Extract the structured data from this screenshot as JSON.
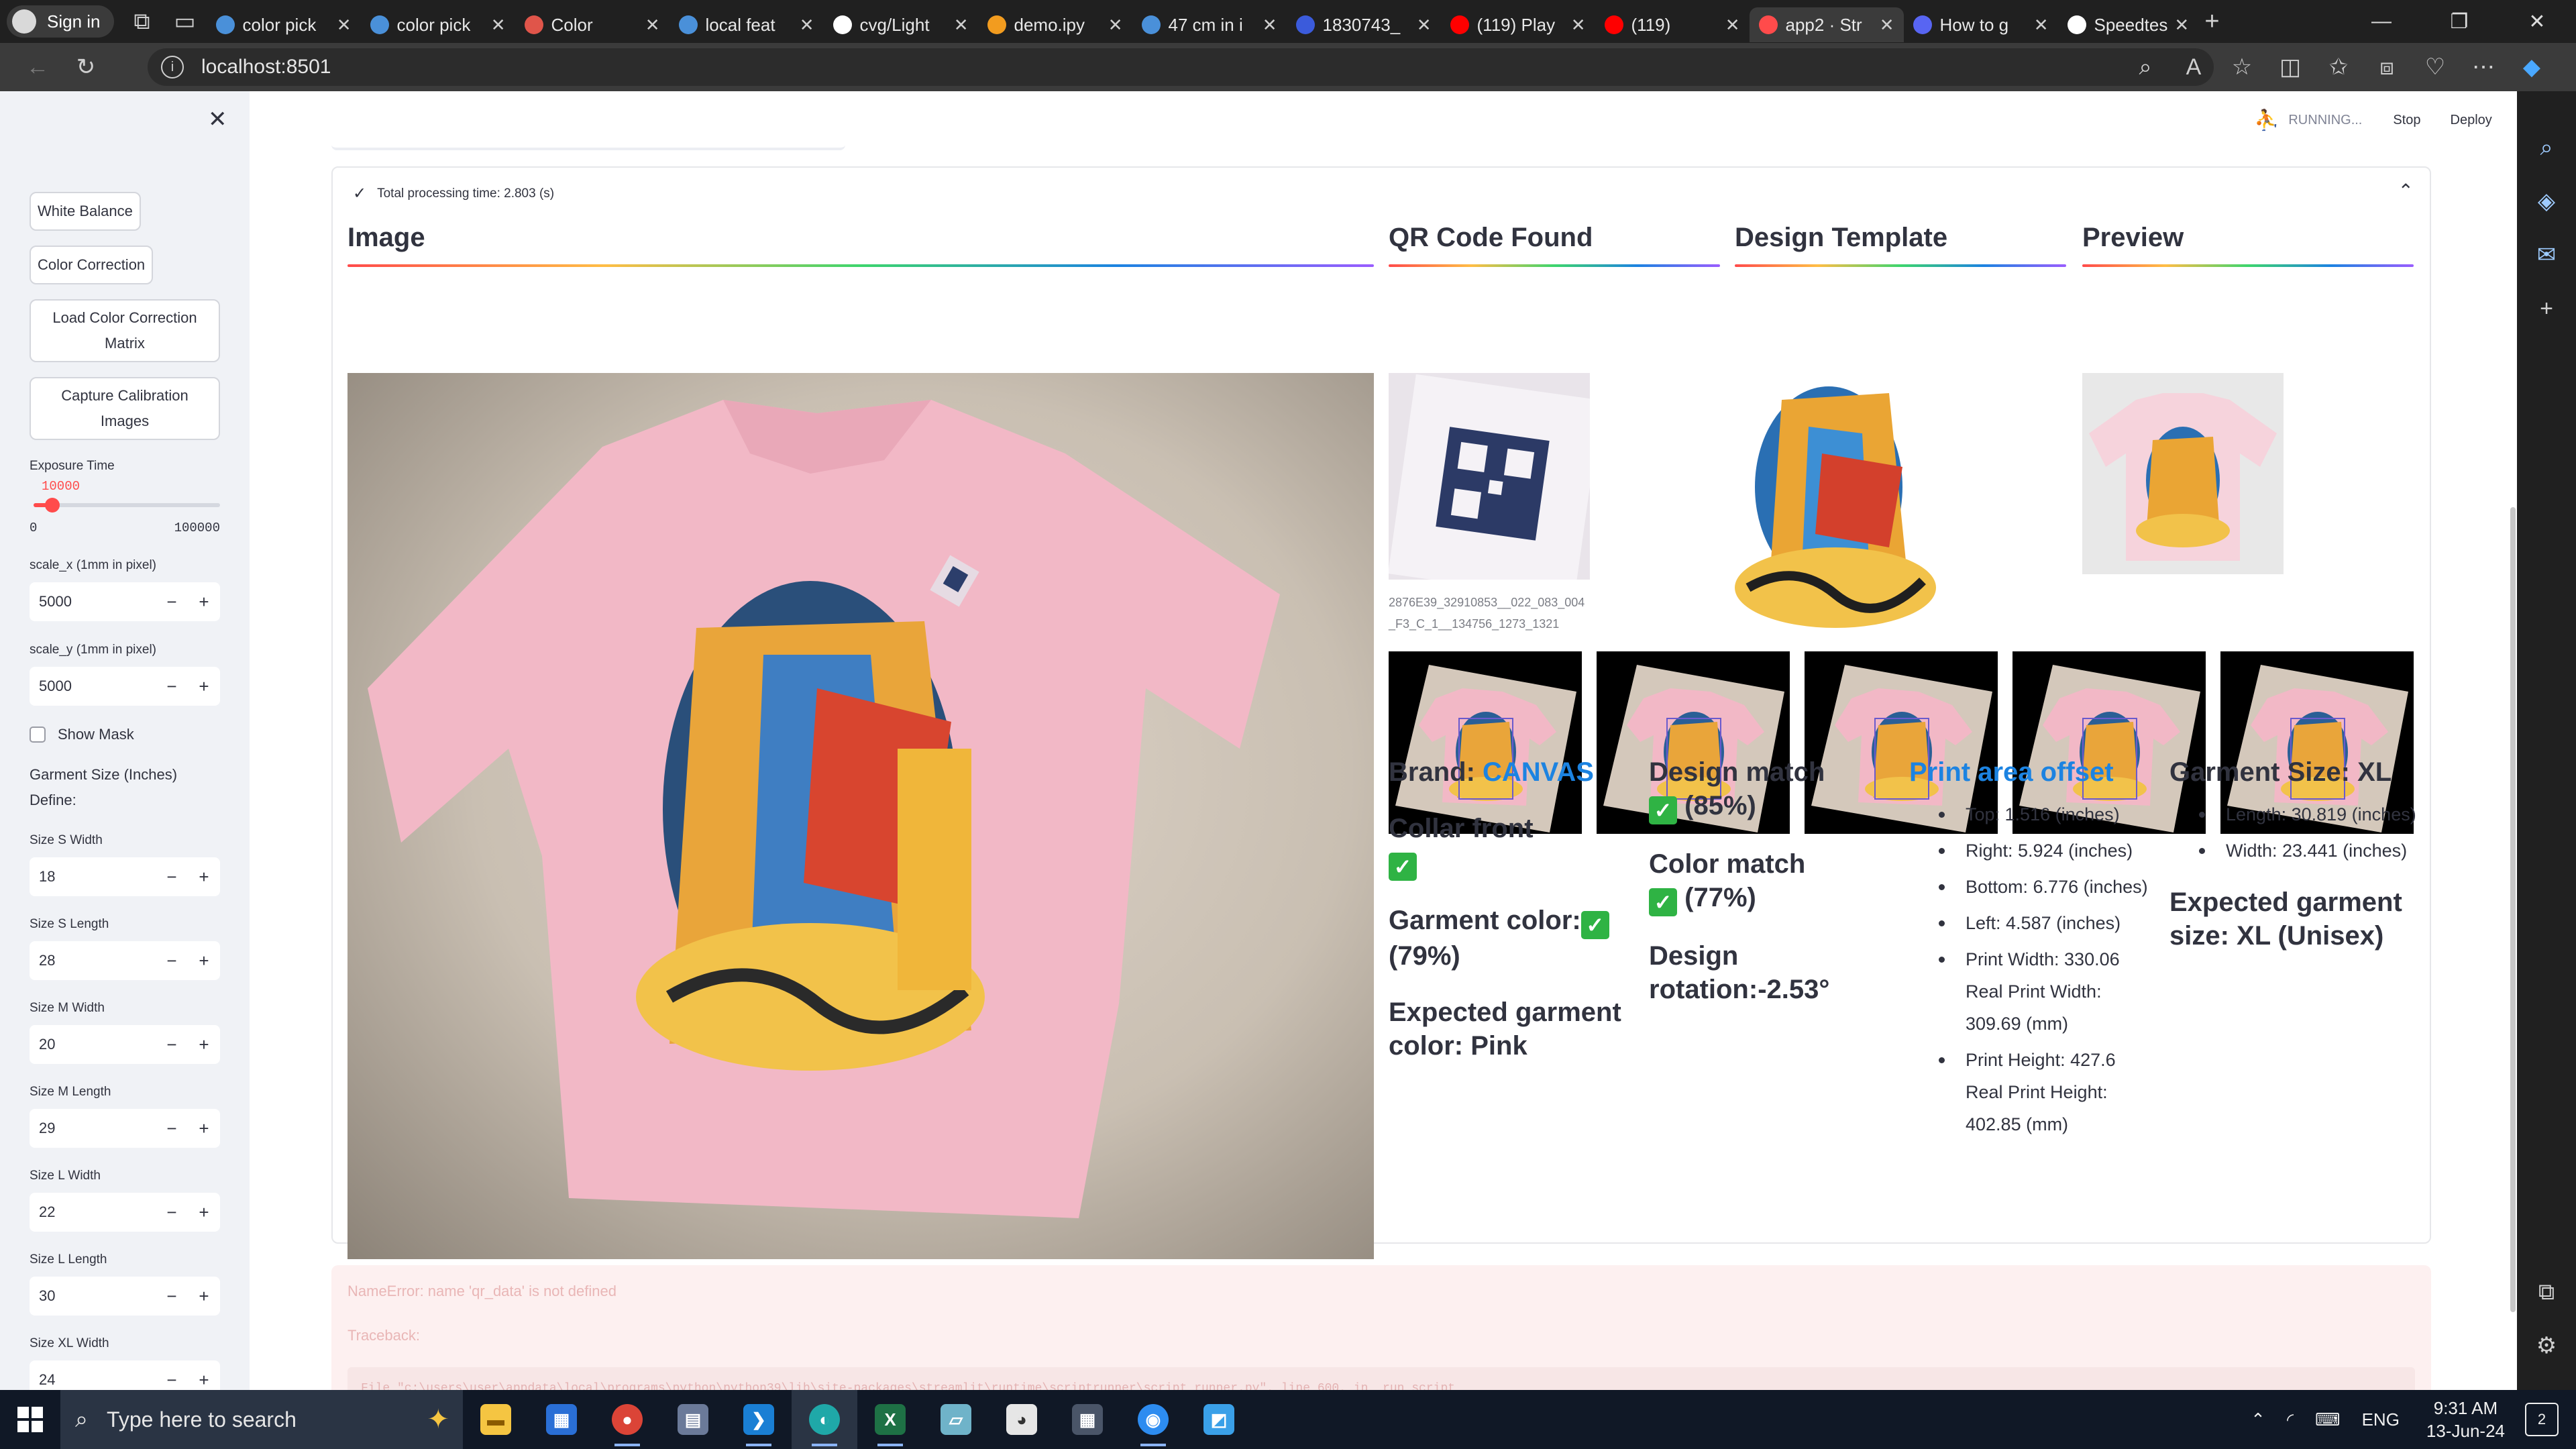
{
  "browser": {
    "profile_label": "Sign in",
    "tabs": [
      {
        "title": "color pick",
        "fav_color": "#4a90d9"
      },
      {
        "title": "color pick",
        "fav_color": "#4a90d9"
      },
      {
        "title": "Color",
        "fav_color": "#e0554a"
      },
      {
        "title": "local feat",
        "fav_color": "#4a90d9"
      },
      {
        "title": "cvg/Light",
        "fav_color": "#ffffff"
      },
      {
        "title": "demo.ipy",
        "fav_color": "#f29c1f"
      },
      {
        "title": "47 cm in i",
        "fav_color": "#4a90d9"
      },
      {
        "title": "1830743_",
        "fav_color": "#3b5bdb"
      },
      {
        "title": "(119) Play",
        "fav_color": "#ff0000"
      },
      {
        "title": "(119)",
        "fav_color": "#ff0000"
      },
      {
        "title": "app2 · Str",
        "fav_color": "#ff4b4b"
      },
      {
        "title": "How to g",
        "fav_color": "#5865f2"
      },
      {
        "title": "Speedtes",
        "fav_color": "#ffffff"
      }
    ],
    "url": "localhost:8501"
  },
  "app": {
    "header": {
      "status": "RUNNING...",
      "stop": "Stop",
      "deploy": "Deploy"
    },
    "sidebar": {
      "white_balance": "White Balance",
      "color_correction": "Color Correction",
      "load_ccm": "Load Color Correction Matrix",
      "capture_calibration": "Capture Calibration Images",
      "exposure_label": "Exposure Time",
      "exposure_value": "10000",
      "exposure_min": "0",
      "exposure_max": "100000",
      "exposure_fraction": 0.1,
      "scale_x_label": "scale_x (1mm in pixel)",
      "scale_x": "5000",
      "scale_y_label": "scale_y (1mm in pixel)",
      "scale_y": "5000",
      "show_mask": "Show Mask",
      "garment_size_title": "Garment Size (Inches)",
      "define": "Define:",
      "sizes": [
        {
          "label": "Size S Width",
          "value": "18"
        },
        {
          "label": "Size S Length",
          "value": "28"
        },
        {
          "label": "Size M Width",
          "value": "20"
        },
        {
          "label": "Size M Length",
          "value": "29"
        },
        {
          "label": "Size L Width",
          "value": "22"
        },
        {
          "label": "Size L Length",
          "value": "30"
        },
        {
          "label": "Size XL Width",
          "value": "24"
        }
      ]
    },
    "expander": {
      "status": "Total processing time: 2.803 (s)",
      "image_header": "Image",
      "qr_header": "QR Code Found",
      "design_header": "Design Template",
      "preview_header": "Preview",
      "qr_caption": "2876E39_32910853__022_083_004_F3_C_1__134756_1273_1321",
      "brand_label": "Brand:",
      "brand_value": "CANVAS",
      "collar_front": "Collar front",
      "garment_color": "Garment color:",
      "garment_color_pct": "(79%)",
      "expected_color": "Expected garment color: Pink",
      "design_match": "Design match",
      "design_match_pct": "(85%)",
      "color_match": "Color match",
      "color_match_pct": "(77%)",
      "design_rotation": "Design rotation:-2.53°",
      "print_area_title": "Print area offset",
      "print_area": [
        "Top: 1.516 (inches)",
        "Right: 5.924 (inches)",
        "Bottom: 6.776 (inches)",
        "Left: 4.587 (inches)",
        "Print Width: 330.06 Real Print Width: 309.69 (mm)",
        "Print Height: 427.6 Real Print Height: 402.85 (mm)"
      ],
      "garment_size_title": "Garment Size: XL",
      "garment_size": [
        "Length: 30.819 (inches)",
        "Width: 23.441 (inches)"
      ],
      "expected_size": "Expected garment size: XL (Unisex)"
    },
    "error": {
      "message": "NameError: name 'qr_data' is not defined",
      "traceback": "Traceback:",
      "code": "File \"c:\\users\\user\\appdata\\local\\programs\\python\\python39\\lib\\site-packages\\streamlit\\runtime\\scriptrunner\\script_runner.py\", line 600, in _run_script"
    }
  },
  "taskbar": {
    "search_placeholder": "Type here to search",
    "language": "ENG",
    "time": "9:31 AM",
    "date": "13-Jun-24",
    "notifications": "2"
  },
  "colors": {
    "accent": "#ff4b4b",
    "link_blue": "#1c83e1",
    "check_green": "#2fb344",
    "shirt_pink": "#f2b8c6"
  }
}
